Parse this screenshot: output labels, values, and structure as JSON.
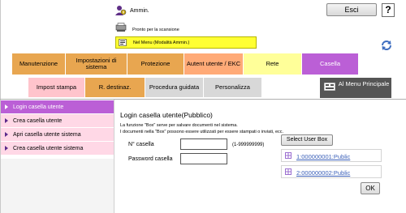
{
  "header": {
    "user_name": "Ammin.",
    "logout_label": "Esci",
    "help_label": "?",
    "status_text": "Pronto per la scansione",
    "mode_text": "Nel Menu (Modalità Ammin.)"
  },
  "tabs_row1": [
    {
      "label": "Manutenzione",
      "color": "#e8a650"
    },
    {
      "label": "Impostazioni di sistema",
      "color": "#e8a650"
    },
    {
      "label": "Protezione",
      "color": "#e8a650"
    },
    {
      "label": "Autent utente / EKC",
      "color": "#ffaa77"
    },
    {
      "label": "Rete",
      "color": "#ffff99"
    },
    {
      "label": "Casella",
      "color": "#bb5fd6"
    }
  ],
  "tabs_row2": [
    {
      "label": "Impost stampa",
      "color": "#ffc4cc"
    },
    {
      "label": "R. destinaz.",
      "color": "#e8a650"
    },
    {
      "label": "Procedura guidata",
      "color": "#d8d8d8"
    },
    {
      "label": "Personalizza",
      "color": "#d8d8d8"
    }
  ],
  "nav_ai": {
    "label": "Al Menu Principale"
  },
  "sidebar": {
    "items": [
      {
        "label": "Login casella utente",
        "active": true
      },
      {
        "label": "Crea casella utente",
        "active": false
      },
      {
        "label": "Apri casella utente sistema",
        "active": false
      },
      {
        "label": "Crea casella utente sistema",
        "active": false
      }
    ]
  },
  "main": {
    "title": "Login casella utente(Pubblico)",
    "desc_line1": "La funzione \"Box\" serve per salvare documenti nel sistema.",
    "desc_line2": "I documenti nella \"Box\" possono essere utilizzati per essere stampati o inviati, ecc.",
    "box_number_label": "N° casella",
    "box_number_value": "",
    "box_number_range": "(1-999999999)",
    "password_label": "Password casella",
    "password_value": "",
    "select_button": "Select User Box",
    "boxes": [
      {
        "label": "1:000000001:Public"
      },
      {
        "label": "2:000000002:Public"
      }
    ],
    "ok_label": "OK"
  }
}
